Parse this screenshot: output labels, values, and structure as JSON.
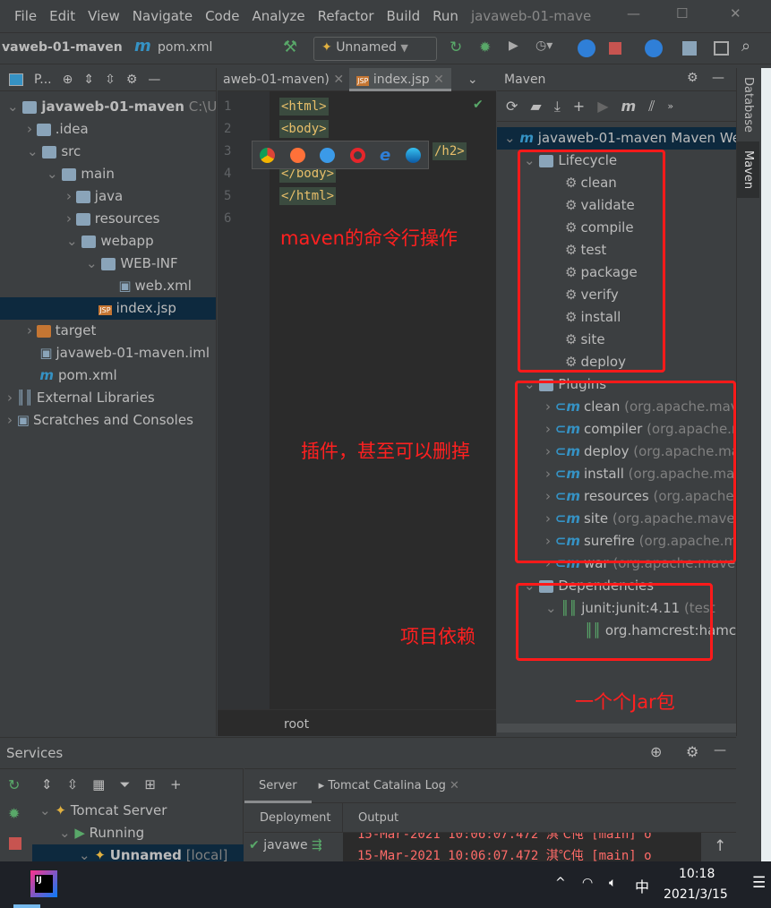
{
  "menu": {
    "items": [
      "File",
      "Edit",
      "View",
      "Navigate",
      "Code",
      "Analyze",
      "Refactor",
      "Build",
      "Run"
    ],
    "window_title": "javaweb-01-mave"
  },
  "nav": {
    "project": "vaweb-01-maven",
    "file": "pom.xml",
    "run_config": "Unnamed"
  },
  "project_panel": {
    "title": "P...",
    "items": [
      {
        "label": "javaweb-01-maven",
        "extra": "C:\\Us",
        "depth": 0,
        "icon": "module"
      },
      {
        "label": ".idea",
        "depth": 1,
        "icon": "folder"
      },
      {
        "label": "src",
        "depth": 1,
        "icon": "folder"
      },
      {
        "label": "main",
        "depth": 2,
        "icon": "folder"
      },
      {
        "label": "java",
        "depth": 3,
        "icon": "source-folder"
      },
      {
        "label": "resources",
        "depth": 3,
        "icon": "resources-folder"
      },
      {
        "label": "webapp",
        "depth": 3,
        "icon": "web-folder"
      },
      {
        "label": "WEB-INF",
        "depth": 4,
        "icon": "folder"
      },
      {
        "label": "web.xml",
        "depth": 5,
        "icon": "xml-file"
      },
      {
        "label": "index.jsp",
        "depth": 4,
        "icon": "jsp-file",
        "selected": true
      },
      {
        "label": "target",
        "depth": 1,
        "icon": "excluded-folder"
      },
      {
        "label": "javaweb-01-maven.iml",
        "depth": 1,
        "icon": "iml-file"
      },
      {
        "label": "pom.xml",
        "depth": 1,
        "icon": "maven-file"
      },
      {
        "label": "External Libraries",
        "depth": 0,
        "icon": "library"
      },
      {
        "label": "Scratches and Consoles",
        "depth": 0,
        "icon": "scratch"
      }
    ]
  },
  "editor": {
    "tabs": [
      "aweb-01-maven)",
      "index.jsp"
    ],
    "lines": [
      "<html>",
      "<body>",
      "/h2>",
      "</body>",
      "</html>",
      ""
    ],
    "breadcrumb": "root",
    "browsers": [
      "chrome",
      "firefox",
      "safari",
      "opera",
      "ie",
      "edge"
    ]
  },
  "maven": {
    "title": "Maven",
    "root": "javaweb-01-maven Maven We",
    "lifecycle_label": "Lifecycle",
    "lifecycle": [
      "clean",
      "validate",
      "compile",
      "test",
      "package",
      "verify",
      "install",
      "site",
      "deploy"
    ],
    "plugins_label": "Plugins",
    "plugins": [
      {
        "name": "clean",
        "group": "(org.apache.mave"
      },
      {
        "name": "compiler",
        "group": "(org.apache.m"
      },
      {
        "name": "deploy",
        "group": "(org.apache.ma"
      },
      {
        "name": "install",
        "group": "(org.apache.mave"
      },
      {
        "name": "resources",
        "group": "(org.apache.r"
      },
      {
        "name": "site",
        "group": "(org.apache.maven."
      },
      {
        "name": "surefire",
        "group": "(org.apache.ma"
      },
      {
        "name": "war",
        "group": "(org.apache.maven."
      }
    ],
    "dependencies_label": "Dependencies",
    "deps": [
      {
        "name": "junit:junit:4.11",
        "scope": "(test"
      },
      {
        "name": "org.hamcrest:hamcre",
        "scope": ""
      }
    ]
  },
  "side_tabs": [
    "Database",
    "Maven"
  ],
  "annotations": {
    "lifecycle": "maven的命令行操作",
    "plugins": "插件，甚至可以删掉",
    "deps": "项目依赖",
    "jar": "一个个Jar包"
  },
  "services": {
    "title": "Services",
    "tabs": [
      "Server",
      "Tomcat Catalina Log"
    ],
    "subtabs": [
      "Deployment",
      "Output"
    ],
    "tree": [
      "Tomcat Server",
      "Running",
      "Unnamed"
    ],
    "local": "[local]",
    "deployment": "javawe",
    "log": [
      "15-Mar-2021 10:06:07.472 淇℃伅 [main] o",
      "15-Mar-2021 10:06:07.472 淇℃伅 [main] o"
    ]
  },
  "taskbar": {
    "time": "10:18",
    "date": "2021/3/15",
    "ime": "中"
  },
  "colors": {
    "selection": "#0d293e",
    "annotation": "#ff1a1a",
    "log": "#ff6b68"
  }
}
